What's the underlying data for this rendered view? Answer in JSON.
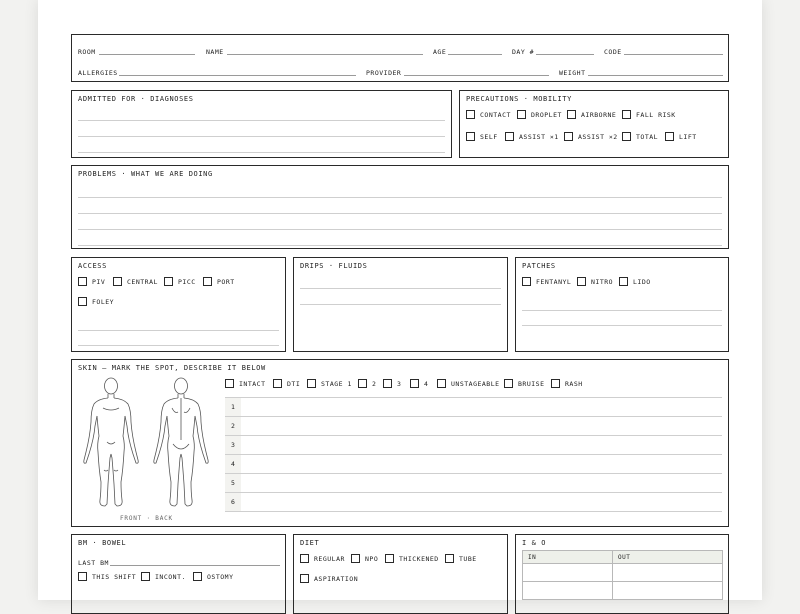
{
  "header": {
    "room_label": "ROOM",
    "name_label": "NAME",
    "age_label": "AGE",
    "day_label": "DAY #",
    "code_label": "CODE",
    "allergies_label": "ALLERGIES",
    "provider_label": "PROVIDER",
    "weight_label": "WEIGHT"
  },
  "admitted": {
    "title": "ADMITTED FOR · DIAGNOSES"
  },
  "precautions": {
    "title": "PRECAUTIONS · MOBILITY",
    "options": [
      "CONTACT",
      "DROPLET",
      "AIRBORNE",
      "FALL RISK",
      "SELF",
      "ASSIST ×1",
      "ASSIST ×2",
      "TOTAL",
      "LIFT"
    ]
  },
  "problems": {
    "title": "PROBLEMS · WHAT WE ARE DOING"
  },
  "access": {
    "title": "ACCESS",
    "options": [
      "PIV",
      "CENTRAL",
      "PICC",
      "PORT",
      "FOLEY"
    ]
  },
  "drips": {
    "title": "DRIPS · FLUIDS"
  },
  "patches": {
    "title": "PATCHES",
    "options": [
      "FENTANYL",
      "NITRO",
      "LIDO"
    ]
  },
  "skin": {
    "title": "SKIN — MARK THE SPOT, DESCRIBE IT BELOW",
    "options": [
      "INTACT",
      "DTI",
      "STAGE 1",
      "2",
      "3",
      "4",
      "UNSTAGEABLE",
      "BRUISE",
      "RASH"
    ],
    "rows": [
      "1",
      "2",
      "3",
      "4",
      "5",
      "6"
    ],
    "caption": "FRONT · BACK"
  },
  "bm": {
    "title": "BM · BOWEL",
    "last_label": "LAST BM",
    "options": [
      "THIS SHIFT",
      "INCONT.",
      "OSTOMY"
    ]
  },
  "diet": {
    "title": "DIET",
    "options": [
      "REGULAR",
      "NPO",
      "THICKENED",
      "TUBE",
      "ASPIRATION"
    ]
  },
  "io": {
    "title": "I & O",
    "in_label": "IN",
    "out_label": "OUT"
  }
}
